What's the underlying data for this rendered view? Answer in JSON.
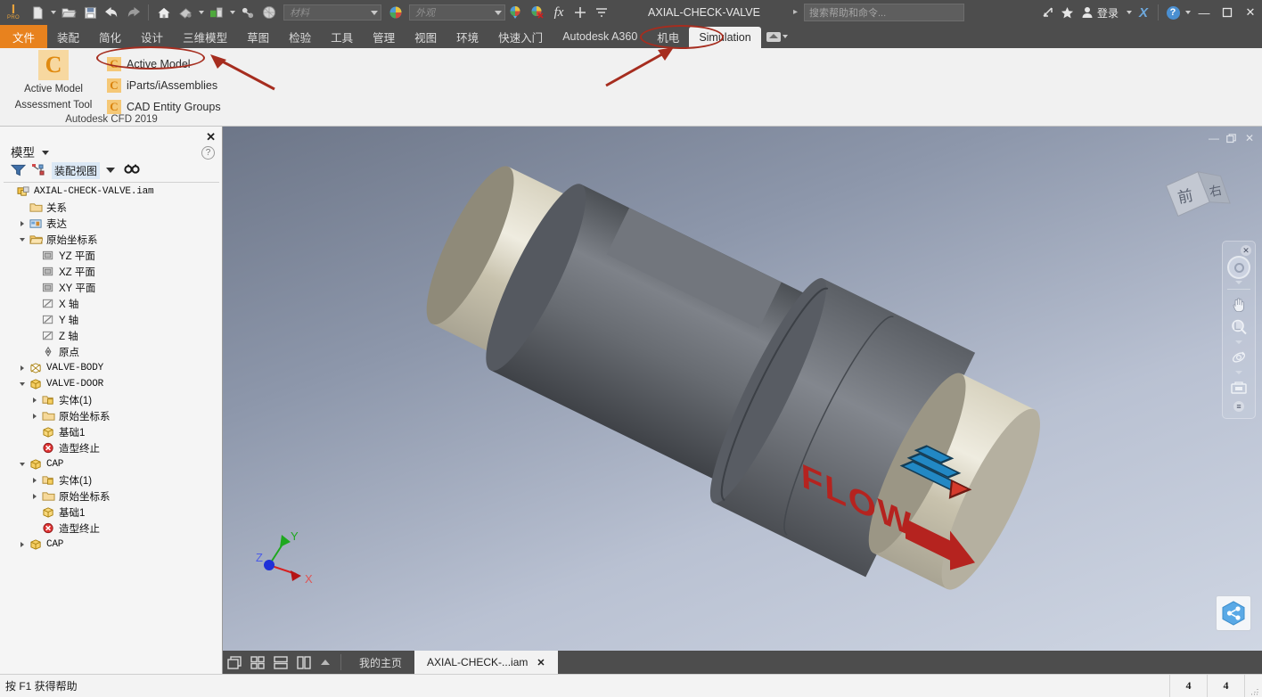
{
  "app": {
    "document_title": "AXIAL-CHECK-VALVE",
    "logo_label": "PRO"
  },
  "quick_access": {
    "items": [
      {
        "name": "new-document-icon",
        "label": "新建"
      },
      {
        "name": "open-document-icon",
        "label": "打开"
      },
      {
        "name": "save-icon",
        "label": "保存"
      },
      {
        "name": "undo-icon",
        "label": "撤消"
      },
      {
        "name": "redo-icon",
        "label": "重做"
      },
      {
        "name": "home-icon",
        "label": "主页"
      },
      {
        "name": "paint-icon",
        "label": "外观"
      },
      {
        "name": "update-icon",
        "label": "更新"
      },
      {
        "name": "joint-icon",
        "label": "连接"
      },
      {
        "name": "material-ball-icon",
        "label": "材料球"
      }
    ],
    "material_placeholder": "材料",
    "appearance_placeholder": "外观",
    "material_value": "",
    "appearance_value": "",
    "fx_label": "fx"
  },
  "titlebar": {
    "search_placeholder": "搜索帮助和命令...",
    "sign_in_label": "登录",
    "exchange_icon": "X",
    "help_icon": "?",
    "minimize": "—",
    "maximize": "❐",
    "close": "✕"
  },
  "ribbon_tabs": [
    {
      "label": "文件",
      "active_file": true
    },
    {
      "label": "装配"
    },
    {
      "label": "简化"
    },
    {
      "label": "设计"
    },
    {
      "label": "三维模型"
    },
    {
      "label": "草图"
    },
    {
      "label": "检验"
    },
    {
      "label": "工具"
    },
    {
      "label": "管理"
    },
    {
      "label": "视图"
    },
    {
      "label": "环境"
    },
    {
      "label": "快速入门"
    },
    {
      "label": "Autodesk A360"
    },
    {
      "label": "机电"
    },
    {
      "label": "Simulation",
      "selected": true
    }
  ],
  "ribbon_panel": {
    "big_button_line1": "Active Model",
    "big_button_line2": "Assessment Tool",
    "big_button_glyph": "C",
    "menu_items": [
      {
        "label": "Active Model",
        "glyph": "C",
        "highlighted": true
      },
      {
        "label": "iParts/iAssemblies",
        "glyph": "C"
      },
      {
        "label": "CAD Entity Groups",
        "glyph": "C"
      }
    ],
    "panel_caption": "Autodesk CFD 2019"
  },
  "annotations": {
    "highlight_color": "#a62d1f",
    "targets": [
      "Active Model",
      "Simulation"
    ]
  },
  "browser": {
    "title": "模型",
    "view_selector": "装配视图",
    "close_label": "✕",
    "help_label": "?",
    "tools": [
      {
        "name": "filter-icon",
        "label": "过滤器"
      },
      {
        "name": "assembly-view-icon",
        "label": "装配视图"
      },
      {
        "name": "find-icon",
        "label": "查找"
      }
    ],
    "tree": [
      {
        "label": "AXIAL-CHECK-VALVE.iam",
        "indent": 0,
        "expand": "none",
        "icon": "assembly-icon",
        "mono": true
      },
      {
        "label": "关系",
        "indent": 1,
        "expand": "none",
        "icon": "folder-icon"
      },
      {
        "label": "表达",
        "indent": 1,
        "expand": "right",
        "icon": "representation-icon"
      },
      {
        "label": "原始坐标系",
        "indent": 1,
        "expand": "down",
        "icon": "folder-open-icon"
      },
      {
        "label": "YZ 平面",
        "indent": 2,
        "expand": "none",
        "icon": "plane-icon"
      },
      {
        "label": "XZ 平面",
        "indent": 2,
        "expand": "none",
        "icon": "plane-icon"
      },
      {
        "label": "XY 平面",
        "indent": 2,
        "expand": "none",
        "icon": "plane-icon"
      },
      {
        "label": "X 轴",
        "indent": 2,
        "expand": "none",
        "icon": "axis-icon"
      },
      {
        "label": "Y 轴",
        "indent": 2,
        "expand": "none",
        "icon": "axis-icon"
      },
      {
        "label": "Z 轴",
        "indent": 2,
        "expand": "none",
        "icon": "axis-icon"
      },
      {
        "label": "原点",
        "indent": 2,
        "expand": "none",
        "icon": "point-icon"
      },
      {
        "label": "VALVE-BODY",
        "indent": 1,
        "expand": "right",
        "icon": "part-hidden-icon",
        "mono": true
      },
      {
        "label": "VALVE-DOOR",
        "indent": 1,
        "expand": "down",
        "icon": "part-icon",
        "mono": true
      },
      {
        "label": "实体(1)",
        "indent": 2,
        "expand": "right",
        "icon": "solid-icon"
      },
      {
        "label": "原始坐标系",
        "indent": 2,
        "expand": "right",
        "icon": "folder-icon"
      },
      {
        "label": "基础1",
        "indent": 2,
        "expand": "none",
        "icon": "base-icon"
      },
      {
        "label": "造型终止",
        "indent": 2,
        "expand": "none",
        "icon": "end-of-part-icon"
      },
      {
        "label": "CAP",
        "indent": 1,
        "expand": "down",
        "icon": "part-icon",
        "mono": true
      },
      {
        "label": "实体(1)",
        "indent": 2,
        "expand": "right",
        "icon": "solid-icon"
      },
      {
        "label": "原始坐标系",
        "indent": 2,
        "expand": "right",
        "icon": "folder-icon"
      },
      {
        "label": "基础1",
        "indent": 2,
        "expand": "none",
        "icon": "base-icon"
      },
      {
        "label": "造型终止",
        "indent": 2,
        "expand": "none",
        "icon": "end-of-part-icon"
      },
      {
        "label": "CAP",
        "indent": 1,
        "expand": "right",
        "icon": "part-icon",
        "mono": true
      }
    ]
  },
  "viewport": {
    "minimize": "—",
    "restore": "❐",
    "close": "✕",
    "viewcube_front": "前",
    "viewcube_right": "右",
    "model_decal_text": "FLOW",
    "axis_x": "X",
    "axis_y": "Y",
    "axis_z": "Z",
    "colors": {
      "body": "#6e7176",
      "cap": "#cdc8b4",
      "decal_red": "#b5231f",
      "logo_blue": "#2288c4",
      "background_top": "#6d7688",
      "background_bottom": "#cfd6e3"
    },
    "nav_tools": [
      {
        "name": "steering-wheel-icon",
        "label": "全导航控制盘"
      },
      {
        "name": "pan-hand-icon",
        "label": "平移"
      },
      {
        "name": "zoom-magnifier-icon",
        "label": "缩放"
      },
      {
        "name": "orbit-icon",
        "label": "动态观察"
      },
      {
        "name": "look-at-icon",
        "label": "观察"
      }
    ]
  },
  "bottom_bar": {
    "view_buttons": [
      {
        "name": "cascade-windows-icon",
        "label": "层叠"
      },
      {
        "name": "tile-windows-icon",
        "label": "平铺"
      },
      {
        "name": "tile-horizontal-icon",
        "label": "水平平铺"
      },
      {
        "name": "tile-vertical-icon",
        "label": "垂直平铺"
      }
    ],
    "tabs": [
      {
        "label": "我的主页",
        "active": false,
        "closable": false
      },
      {
        "label": "AXIAL-CHECK-...iam",
        "active": true,
        "closable": true,
        "close_label": "✕"
      }
    ]
  },
  "status_bar": {
    "message": "按 F1 获得帮助",
    "value_1": "4",
    "value_2": "4"
  }
}
